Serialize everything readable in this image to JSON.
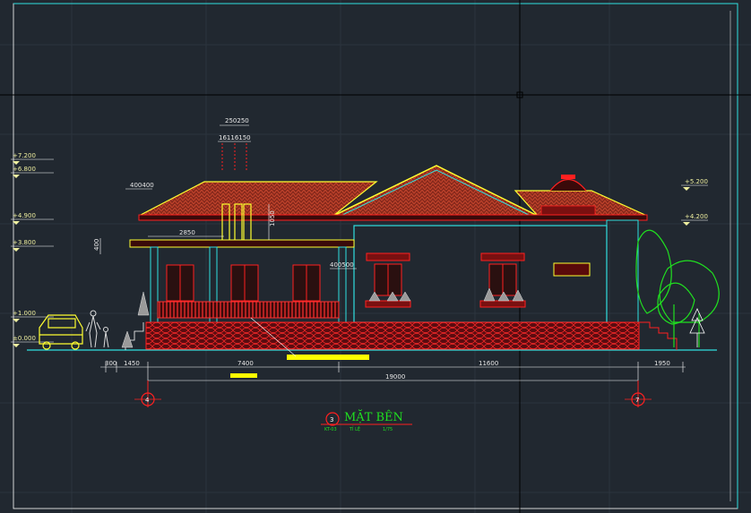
{
  "drawing": {
    "title": "MẶT BÊN",
    "number": "3",
    "sheet_ref": "KT-03",
    "scale_left": "TỈ LỆ",
    "scale_right": "1/75"
  },
  "levels_left": [
    "+7.200",
    "+6.800",
    "+4.900",
    "+3.800",
    "+1.000",
    "±0.000"
  ],
  "levels_right": [
    "+5.200",
    "+4.200"
  ],
  "dimensions": {
    "top_chimney_a": "250250",
    "top_chimney_b": "16116150",
    "overhang": "400400",
    "eave_left": "2850",
    "eave_height": "1050",
    "side_height": "400",
    "porch_gap": "400500",
    "bottom_a": "300",
    "bottom_b": "1450",
    "bottom_c": "7400",
    "bottom_d": "11600",
    "bottom_e": "1950",
    "overall": "19000"
  },
  "grid_axes": [
    "4",
    "7"
  ],
  "colors": {
    "background": "#212830",
    "roof": "#c0281c",
    "outline": "#ffff30",
    "cyan": "#30e0e0",
    "green": "#20e020",
    "red": "#ff2020",
    "white": "#ffffff"
  }
}
